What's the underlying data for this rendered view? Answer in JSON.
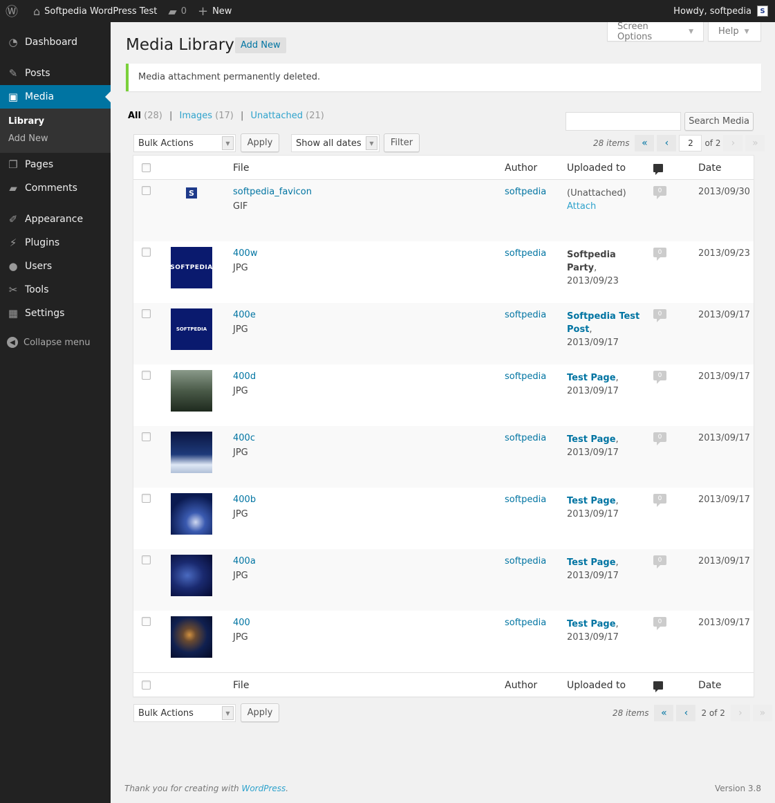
{
  "adminbar": {
    "site_name": "Softpedia WordPress Test",
    "comments_count": "0",
    "new_label": "New",
    "howdy": "Howdy, softpedia",
    "avatar_letter": "S"
  },
  "sidebar": {
    "items": [
      {
        "label": "Dashboard",
        "icon": "dashboard-icon"
      },
      {
        "label": "Posts",
        "icon": "pin-icon"
      },
      {
        "label": "Media",
        "icon": "media-icon"
      },
      {
        "label": "Pages",
        "icon": "pages-icon"
      },
      {
        "label": "Comments",
        "icon": "comments-icon"
      },
      {
        "label": "Appearance",
        "icon": "brush-icon"
      },
      {
        "label": "Plugins",
        "icon": "plugin-icon"
      },
      {
        "label": "Users",
        "icon": "user-icon"
      },
      {
        "label": "Tools",
        "icon": "wrench-icon"
      },
      {
        "label": "Settings",
        "icon": "settings-icon"
      }
    ],
    "submenu": [
      "Library",
      "Add New"
    ],
    "collapse": "Collapse menu"
  },
  "tabs": {
    "screen_options": "Screen Options",
    "help": "Help"
  },
  "page": {
    "title": "Media Library",
    "add_new": "Add New",
    "notice": "Media attachment permanently deleted."
  },
  "filters": {
    "all": "All",
    "all_count": "(28)",
    "images": "Images",
    "images_count": "(17)",
    "unattached": "Unattached",
    "unattached_count": "(21)",
    "separator": "|"
  },
  "search": {
    "button": "Search Media",
    "value": ""
  },
  "tablenav_top": {
    "bulk": "Bulk Actions",
    "apply": "Apply",
    "dates": "Show all dates",
    "filter": "Filter",
    "items": "28 items",
    "first": "«",
    "prev": "‹",
    "page": "2",
    "of": "of 2",
    "next": "›",
    "last": "»"
  },
  "tablenav_bottom": {
    "bulk": "Bulk Actions",
    "apply": "Apply",
    "items": "28 items",
    "first": "«",
    "prev": "‹",
    "page_text": "2 of 2",
    "next": "›",
    "last": "»"
  },
  "columns": {
    "file": "File",
    "author": "Author",
    "uploaded": "Uploaded to",
    "date": "Date"
  },
  "rows": [
    {
      "name": "softpedia_favicon",
      "type": "GIF",
      "author": "softpedia",
      "up_line1": "(Unattached)",
      "up_link": "Attach",
      "up_line2": "",
      "comments": "0",
      "date": "2013/09/30"
    },
    {
      "name": "400w",
      "type": "JPG",
      "author": "softpedia",
      "up_link": "Softpedia Party",
      "up_suffix": ",",
      "up_date": "2013/09/23",
      "comments": "0",
      "date": "2013/09/23",
      "thumb_text": "SOFTPEDIA"
    },
    {
      "name": "400e",
      "type": "JPG",
      "author": "softpedia",
      "up_link": "Softpedia Test Post",
      "up_suffix": ",",
      "up_date": "2013/09/17",
      "comments": "0",
      "date": "2013/09/17",
      "thumb_text": "SOFTPEDIA"
    },
    {
      "name": "400d",
      "type": "JPG",
      "author": "softpedia",
      "up_link": "Test Page",
      "up_suffix": ",",
      "up_date": "2013/09/17",
      "comments": "0",
      "date": "2013/09/17"
    },
    {
      "name": "400c",
      "type": "JPG",
      "author": "softpedia",
      "up_link": "Test Page",
      "up_suffix": ",",
      "up_date": "2013/09/17",
      "comments": "0",
      "date": "2013/09/17"
    },
    {
      "name": "400b",
      "type": "JPG",
      "author": "softpedia",
      "up_link": "Test Page",
      "up_suffix": ",",
      "up_date": "2013/09/17",
      "comments": "0",
      "date": "2013/09/17"
    },
    {
      "name": "400a",
      "type": "JPG",
      "author": "softpedia",
      "up_link": "Test Page",
      "up_suffix": ",",
      "up_date": "2013/09/17",
      "comments": "0",
      "date": "2013/09/17"
    },
    {
      "name": "400",
      "type": "JPG",
      "author": "softpedia",
      "up_link": "Test Page",
      "up_suffix": ",",
      "up_date": "2013/09/17",
      "comments": "0",
      "date": "2013/09/17"
    }
  ],
  "footer": {
    "thanks_prefix": "Thank you for creating with",
    "wp_link": "WordPress",
    "thanks_suffix": ".",
    "version": "Version 3.8"
  },
  "colors": {
    "accent": "#0074a2",
    "link": "#2ea2cc",
    "notice_border": "#7ad03a",
    "sidebar_bg": "#222222"
  }
}
